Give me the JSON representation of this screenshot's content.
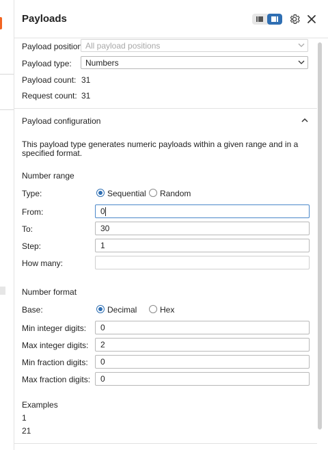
{
  "panel": {
    "title": "Payloads",
    "view_toggle_icons": [
      "list-view-icon",
      "panel-view-icon"
    ],
    "settings_icon": "gear-icon",
    "close_icon": "close-icon"
  },
  "payload": {
    "position_label": "Payload position:",
    "position_value": "All payload positions",
    "type_label": "Payload type:",
    "type_value": "Numbers",
    "count_label": "Payload count:",
    "count_value": "31",
    "request_label": "Request count:",
    "request_value": "31"
  },
  "config": {
    "section_title": "Payload configuration",
    "description": "This payload type generates numeric payloads within a given range and in a specified format.",
    "range": {
      "heading": "Number range",
      "type_label": "Type:",
      "type_options": [
        "Sequential",
        "Random"
      ],
      "type_selected": "Sequential",
      "from_label": "From:",
      "from_value": "0",
      "to_label": "To:",
      "to_value": "30",
      "step_label": "Step:",
      "step_value": "1",
      "how_many_label": "How many:",
      "how_many_value": ""
    },
    "format": {
      "heading": "Number format",
      "base_label": "Base:",
      "base_options": [
        "Decimal",
        "Hex"
      ],
      "base_selected": "Decimal",
      "min_int_label": "Min integer digits:",
      "min_int_value": "0",
      "max_int_label": "Max integer digits:",
      "max_int_value": "2",
      "min_frac_label": "Min fraction digits:",
      "min_frac_value": "0",
      "max_frac_label": "Max fraction digits:",
      "max_frac_value": "0"
    },
    "examples": {
      "heading": "Examples",
      "items": [
        "1",
        "21"
      ]
    }
  },
  "colors": {
    "accent": "#2f6fb3",
    "orange": "#f26522"
  }
}
